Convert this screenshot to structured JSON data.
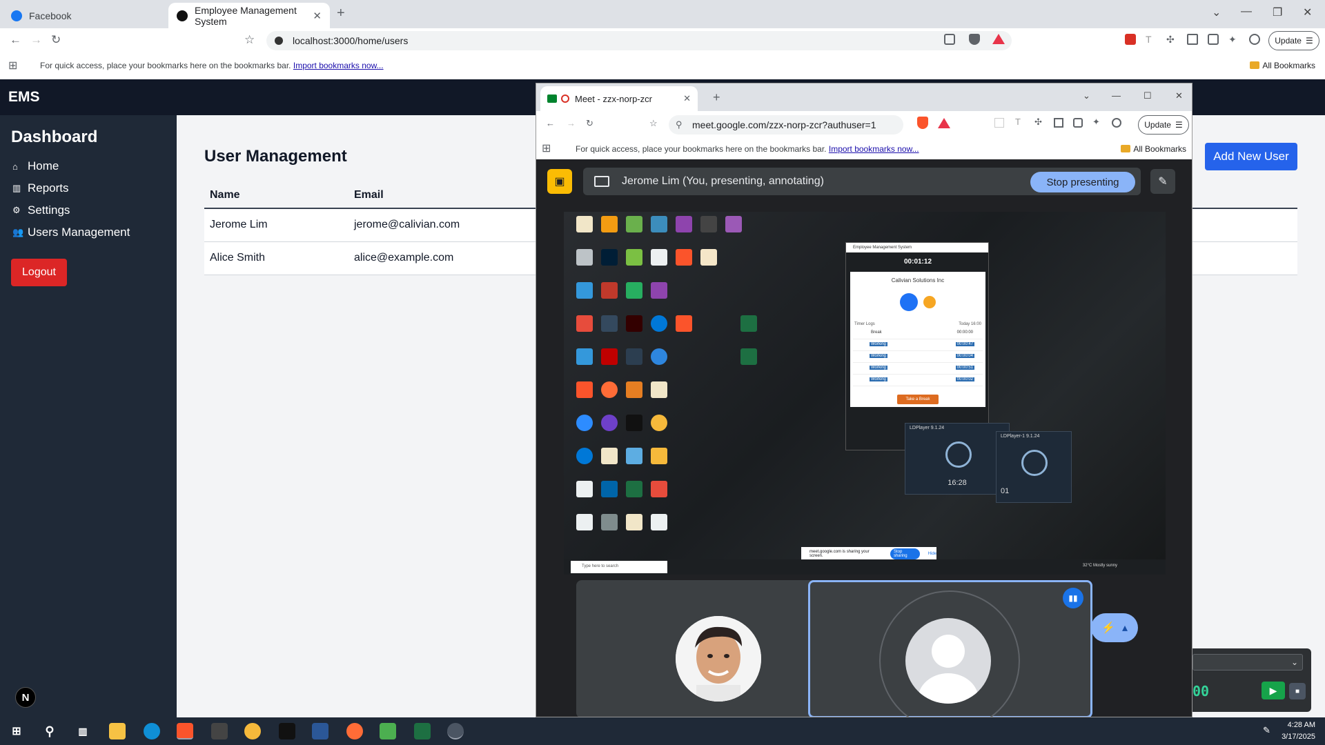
{
  "browser": {
    "tabs": [
      {
        "title": "Facebook",
        "active": false
      },
      {
        "title": "Employee Management System",
        "active": true
      }
    ],
    "url": "localhost:3000/home/users",
    "update_label": "Update",
    "bookmarks_message": "For quick access, place your bookmarks here on the bookmarks bar.",
    "bookmarks_import": "Import bookmarks now...",
    "all_bookmarks": "All Bookmarks"
  },
  "ems": {
    "brand": "EMS",
    "sidebar_title": "Dashboard",
    "nav": [
      {
        "label": "Home",
        "icon": "home-icon"
      },
      {
        "label": "Reports",
        "icon": "chart-icon"
      },
      {
        "label": "Settings",
        "icon": "gear-icon"
      },
      {
        "label": "Users Management",
        "icon": "users-icon"
      }
    ],
    "logout_label": "Logout",
    "n_badge": "N",
    "page_title": "User Management",
    "add_user_label": "Add New User",
    "table": {
      "headers": [
        "Name",
        "Email"
      ],
      "rows": [
        {
          "name": "Jerome Lim",
          "email": "jerome@calivian.com"
        },
        {
          "name": "Alice Smith",
          "email": "alice@example.com"
        }
      ]
    }
  },
  "meet": {
    "tab_title": "Meet - zzx-norp-zcr",
    "url": "meet.google.com/zzx-norp-zcr?authuser=1",
    "update_label": "Update",
    "bookmarks_message": "For quick access, place your bookmarks here on the bookmarks bar.",
    "bookmarks_import": "Import bookmarks now...",
    "all_bookmarks": "All Bookmarks",
    "presenter_text": "Jerome Lim (You, presenting, annotating)",
    "stop_presenting_label": "Stop presenting",
    "shared": {
      "window_title": "Employee Management System",
      "timer": "00:01:12",
      "company": "Calivian Solutions Inc",
      "timer_logs_label": "Timer Logs",
      "today_label": "Today 16:00",
      "logs": [
        {
          "label": "Break",
          "time": "00:00:00"
        },
        {
          "label": "Working",
          "time": "00:00:47"
        },
        {
          "label": "Working",
          "time": "00:00:04"
        },
        {
          "label": "Working",
          "time": "00:00:51"
        },
        {
          "label": "Working",
          "time": "00:00:02"
        }
      ],
      "take_break_label": "Take a Break",
      "ldplayer_title": "LDPlayer 9.1.24",
      "ldplayer_title_2": "LDPlayer-1 9.1.24",
      "ldplayer_time": "16:28",
      "ldplayer_time_2": "01",
      "share_notice": "meet.google.com is sharing your screen.",
      "stop_sharing_label": "Stop sharing",
      "hide_label": "Hide",
      "search_placeholder": "Type here to search",
      "weather": "32°C Mostly sunny"
    }
  },
  "recorder": {
    "time": "00"
  },
  "taskbar": {
    "time": "4:28 AM",
    "date": "3/17/2025"
  }
}
